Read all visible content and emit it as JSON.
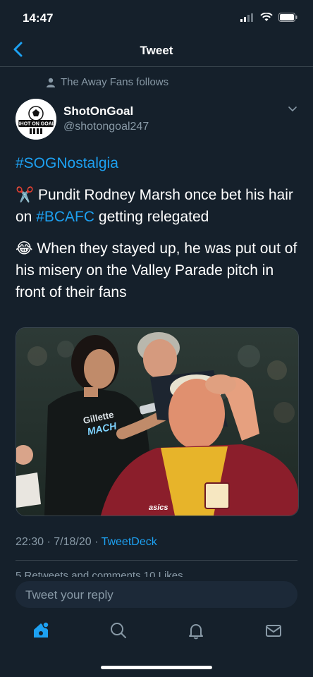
{
  "status": {
    "time": "14:47"
  },
  "nav": {
    "title": "Tweet"
  },
  "tweet": {
    "social_context": "The Away Fans follows",
    "display_name": "ShotOnGoal",
    "handle": "@shotongoal247",
    "avatar_text": "SHOT ON GOAL",
    "hashtag_line": "#SOGNostalgia",
    "line1_prefix": "Pundit Rodney Marsh once bet his hair on ",
    "line1_hashtag": "#BCAFC",
    "line1_suffix": " getting relegated",
    "line2": "When they stayed up, he was put out of his misery on the Valley Parade pitch in front of their fans",
    "emoji1": "✂️",
    "emoji2": "😂",
    "shirt_text_1": "Gillette",
    "shirt_text_2": "MACH",
    "kit_logo": "asics",
    "meta_time": "22:30 · 7/18/20 · ",
    "meta_source": "TweetDeck",
    "counts_text": "5 Retweets and comments   10 Likes"
  },
  "reply": {
    "placeholder": "Tweet your reply"
  },
  "tabs": [
    "home-icon",
    "search-icon",
    "notifications-icon",
    "messages-icon"
  ],
  "colors": {
    "background": "#15202b",
    "accent": "#1da1f2",
    "muted": "#8899a6"
  }
}
